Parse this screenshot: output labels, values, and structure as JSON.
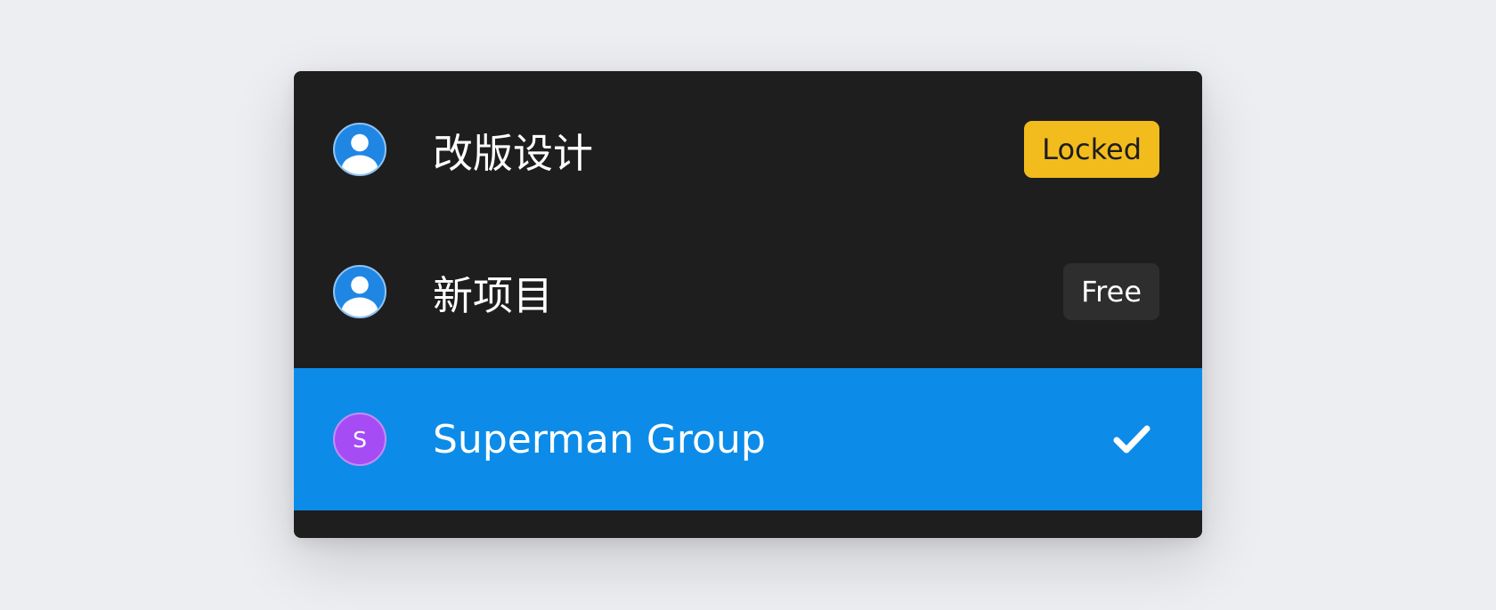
{
  "colors": {
    "background": "#edeef2",
    "menu_background": "#1e1e1e",
    "selected_row": "#0c8ce8",
    "locked_badge": "#f3bc1d",
    "free_badge": "#2e2e2e",
    "user_avatar": "#1f86e4",
    "letter_avatar": "#a64cf5"
  },
  "menu": {
    "items": [
      {
        "icon": "user-avatar-icon",
        "label": "改版设计",
        "badge": "Locked",
        "selected": false
      },
      {
        "icon": "user-avatar-icon",
        "label": "新项目",
        "badge": "Free",
        "selected": false
      },
      {
        "icon": "letter-avatar",
        "avatar_letter": "S",
        "label": "Superman Group",
        "badge": "",
        "check_icon": "checkmark-icon",
        "selected": true
      }
    ]
  }
}
